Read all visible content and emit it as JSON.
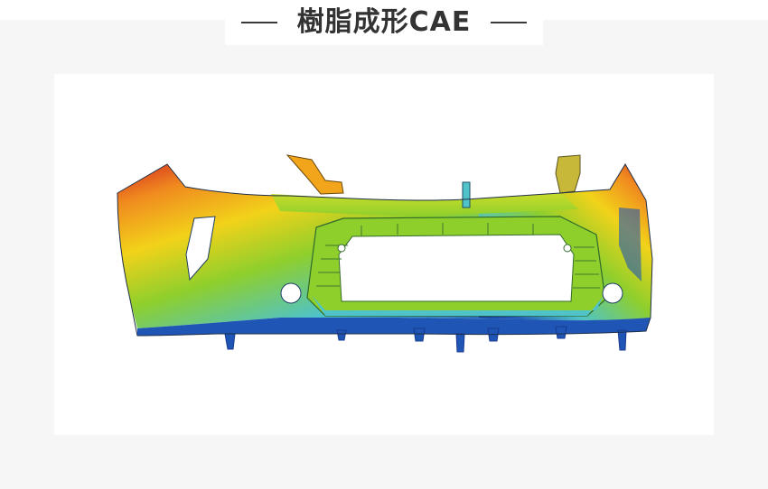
{
  "header": {
    "title": "樹脂成形CAE"
  },
  "figure": {
    "subject": "bumper-simulation-contour",
    "colors": {
      "red": "#d42a1f",
      "orange": "#f08a1f",
      "yellow": "#f2d21a",
      "green": "#8fcf2c",
      "cyan": "#4fc3c8",
      "blue": "#1f55b4",
      "navy": "#173a8f"
    }
  }
}
